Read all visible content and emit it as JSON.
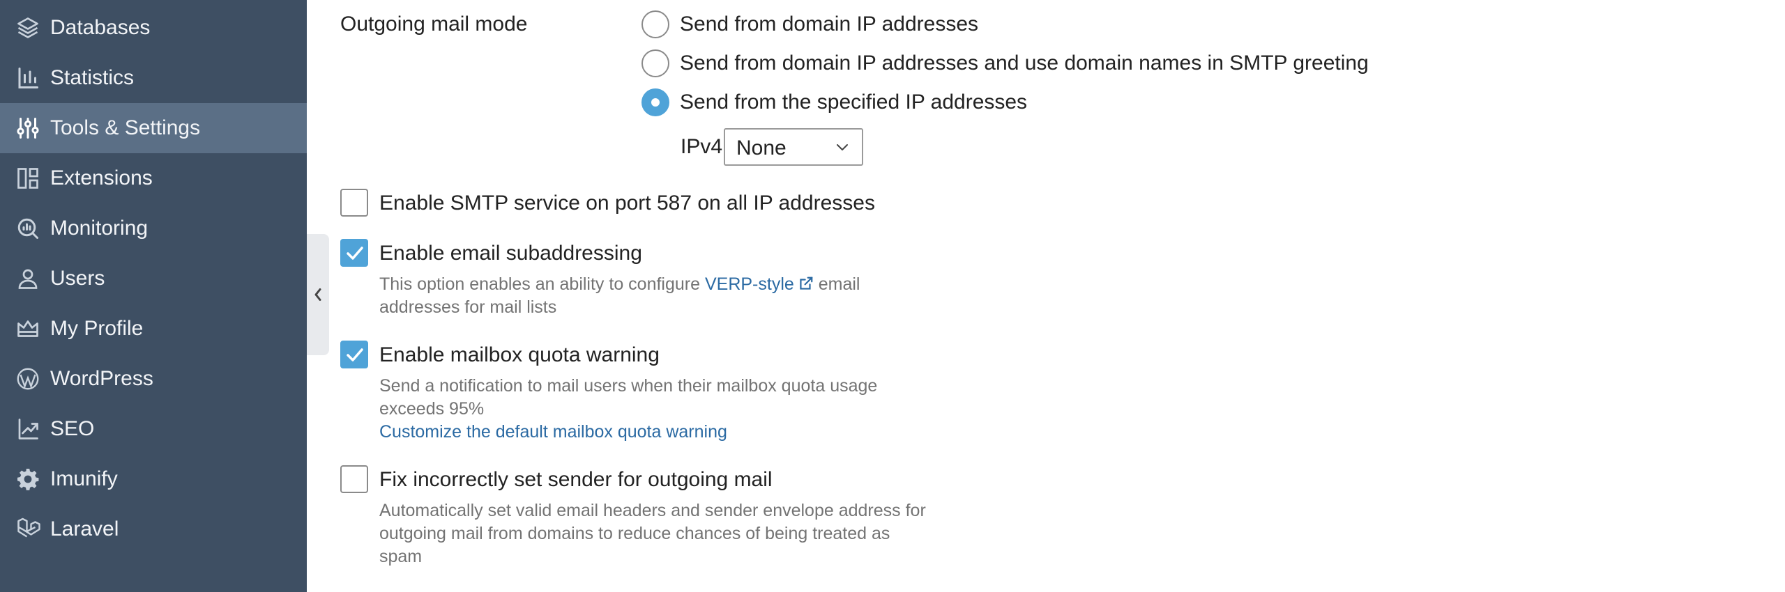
{
  "sidebar": {
    "items": [
      {
        "label": "Databases",
        "icon": "layers-icon"
      },
      {
        "label": "Statistics",
        "icon": "bar-chart-icon"
      },
      {
        "label": "Tools & Settings",
        "icon": "sliders-icon",
        "active": true
      },
      {
        "label": "Extensions",
        "icon": "extensions-icon"
      },
      {
        "label": "Monitoring",
        "icon": "monitoring-icon"
      },
      {
        "label": "Users",
        "icon": "user-icon"
      },
      {
        "label": "My Profile",
        "icon": "crown-icon"
      },
      {
        "label": "WordPress",
        "icon": "wordpress-icon"
      },
      {
        "label": "SEO",
        "icon": "seo-chart-icon"
      },
      {
        "label": "Imunify",
        "icon": "gear-icon"
      },
      {
        "label": "Laravel",
        "icon": "laravel-icon"
      }
    ]
  },
  "form": {
    "outgoing_mode_label": "Outgoing mail mode",
    "radio_options": [
      {
        "label": "Send from domain IP addresses",
        "checked": false
      },
      {
        "label": "Send from domain IP addresses and use domain names in SMTP greeting",
        "checked": false
      },
      {
        "label": "Send from the specified IP addresses",
        "checked": true
      }
    ],
    "ipv4_label": "IPv4",
    "ipv4_value": "None",
    "smtp_587": {
      "label": "Enable SMTP service on port 587 on all IP addresses",
      "checked": false
    },
    "subaddressing": {
      "label": "Enable email subaddressing",
      "checked": true,
      "desc_before": "This option enables an ability to configure ",
      "desc_link": "VERP-style",
      "desc_after_line1": " email",
      "desc_line2": "addresses for mail lists"
    },
    "quota_warning": {
      "label": "Enable mailbox quota warning",
      "checked": true,
      "desc_line1": "Send a notification to mail users when their mailbox quota usage",
      "desc_line2": "exceeds 95%",
      "link": "Customize the default mailbox quota warning"
    },
    "fix_sender": {
      "label": "Fix incorrectly set sender for outgoing mail",
      "checked": false,
      "desc_line1": "Automatically set valid email headers and sender envelope address for",
      "desc_line2": "outgoing mail from domains to reduce chances of being treated as",
      "desc_line3": "spam"
    }
  },
  "colors": {
    "sidebar_bg": "#3e4f63",
    "sidebar_active": "#5b6f86",
    "accent": "#4fa3d8",
    "link": "#2b6aa3"
  }
}
